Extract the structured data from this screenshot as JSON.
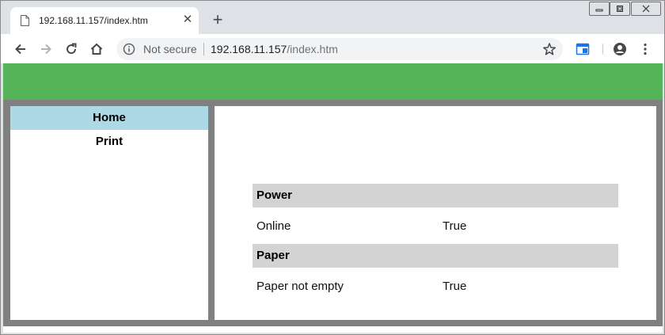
{
  "browser": {
    "tab_title": "192.168.11.157/index.htm",
    "tab_close_glyph": "✕",
    "new_tab_glyph": "+",
    "security_label": "Not secure",
    "url_host": "192.168.11.157",
    "url_path": "/index.htm",
    "icons": [
      "page-icon",
      "close-icon",
      "new-tab-icon",
      "back-icon",
      "forward-icon",
      "reload-icon",
      "home-icon",
      "info-icon",
      "star-icon",
      "extension-icon",
      "account-icon",
      "menu-icon"
    ]
  },
  "sidebar": {
    "items": [
      {
        "label": "Home",
        "active": true
      },
      {
        "label": "Print",
        "active": false
      }
    ]
  },
  "status": {
    "sections": [
      {
        "title": "Power",
        "rows": [
          {
            "key": "Online",
            "value": "True"
          }
        ]
      },
      {
        "title": "Paper",
        "rows": [
          {
            "key": "Paper not empty",
            "value": "True"
          }
        ]
      }
    ]
  },
  "colors": {
    "header_green": "#55b35a",
    "frame_gray": "#808080",
    "nav_active": "#add8e6",
    "section_gray": "#d3d3d3"
  }
}
